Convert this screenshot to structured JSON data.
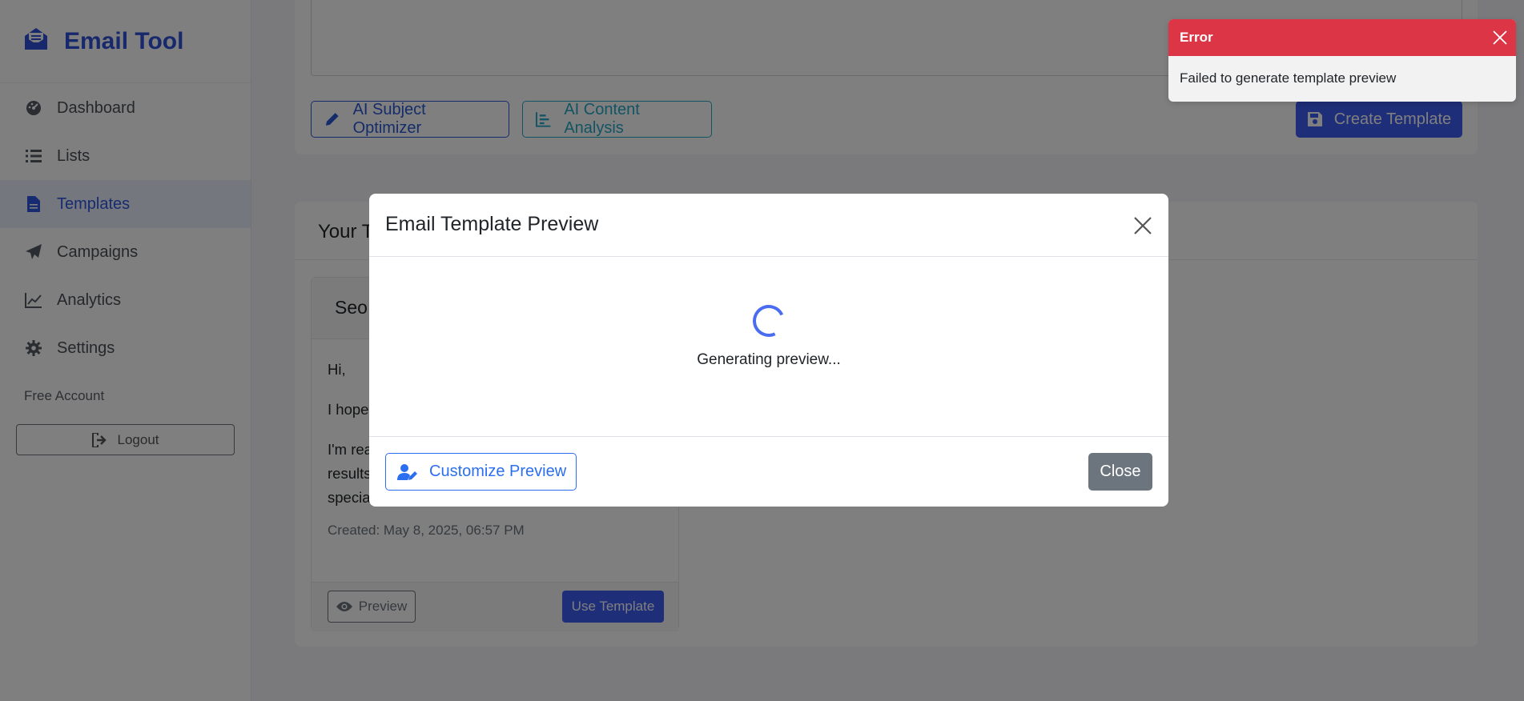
{
  "brand": {
    "name": "Email Tool"
  },
  "sidebar": {
    "items": [
      {
        "label": "Dashboard",
        "icon": "dashboard-icon"
      },
      {
        "label": "Lists",
        "icon": "list-icon"
      },
      {
        "label": "Templates",
        "icon": "document-icon",
        "active": true
      },
      {
        "label": "Campaigns",
        "icon": "paper-plane-icon"
      },
      {
        "label": "Analytics",
        "icon": "chart-line-icon"
      },
      {
        "label": "Settings",
        "icon": "gear-icon"
      }
    ],
    "account_label": "Free Account",
    "logout_label": "Logout"
  },
  "editor": {
    "subject_optimizer_label": "AI Subject Optimizer",
    "content_analysis_label": "AI Content Analysis",
    "create_label": "Create Template"
  },
  "templates": {
    "title": "Your Templates",
    "card": {
      "name": "Seo",
      "body": [
        "Hi,",
        "I hope",
        "I'm rea\nresults\nspecia"
      ],
      "created": "Created: May 8, 2025, 06:57 PM",
      "preview_label": "Preview",
      "use_label": "Use Template"
    }
  },
  "modal": {
    "title": "Email Template Preview",
    "loading_text": "Generating preview...",
    "customize_label": "Customize Preview",
    "close_label": "Close"
  },
  "toast": {
    "title": "Error",
    "message": "Failed to generate template preview",
    "color": "#dc3545"
  },
  "colors": {
    "accent": "#3d5cf0",
    "info": "#25a9c6",
    "secondary": "#6c757d"
  }
}
